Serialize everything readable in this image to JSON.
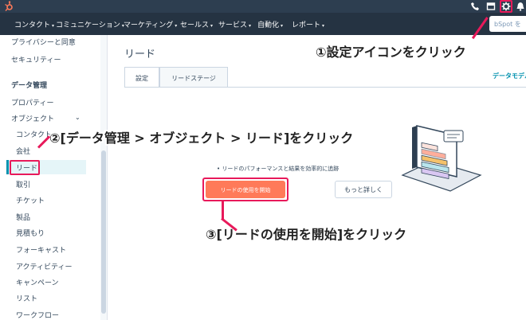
{
  "topbar": {
    "icons": [
      "hubspot-logo",
      "phone-icon",
      "marketplace-icon",
      "gear-icon",
      "bell-icon"
    ]
  },
  "nav": {
    "items": [
      {
        "label": "コンタクト"
      },
      {
        "label": "コミュニケーション"
      },
      {
        "label": "マーケティング"
      },
      {
        "label": "セールス"
      },
      {
        "label": "サービス"
      },
      {
        "label": "自動化"
      },
      {
        "label": "レポート"
      }
    ],
    "search_text": "bSpot を"
  },
  "sidebar": {
    "items": [
      {
        "label": "プライバシーと同意"
      },
      {
        "label": "セキュリティー"
      },
      {
        "label": "データ管理"
      },
      {
        "label": "プロパティー"
      },
      {
        "label": "オブジェクト"
      },
      {
        "label": "コンタクト"
      },
      {
        "label": "会社"
      },
      {
        "label": "リード"
      },
      {
        "label": "取引"
      },
      {
        "label": "チケット"
      },
      {
        "label": "製品"
      },
      {
        "label": "見積もり"
      },
      {
        "label": "フォーキャスト"
      },
      {
        "label": "アクティビティー"
      },
      {
        "label": "キャンペーン"
      },
      {
        "label": "リスト"
      },
      {
        "label": "ワークフロー"
      }
    ]
  },
  "main": {
    "title": "リード",
    "tabs": [
      {
        "label": "設定"
      },
      {
        "label": "リードステージ"
      }
    ],
    "data_model_link": "データモデル",
    "bullet": "リードのパフォーマンスと結果を効率的に追跡",
    "primary_button": "リードの使用を開始",
    "secondary_button": "もっと詳しく"
  },
  "annotations": {
    "step1": "①設定アイコンをクリック",
    "step2": "②[データ管理 > オブジェクト > リード]をクリック",
    "step3": "③[リードの使用を開始]をクリック"
  },
  "colors": {
    "accent_orange": "#ff7a59",
    "highlight_pink": "#e8195a",
    "nav_dark": "#253342",
    "link_teal": "#0091ae"
  }
}
